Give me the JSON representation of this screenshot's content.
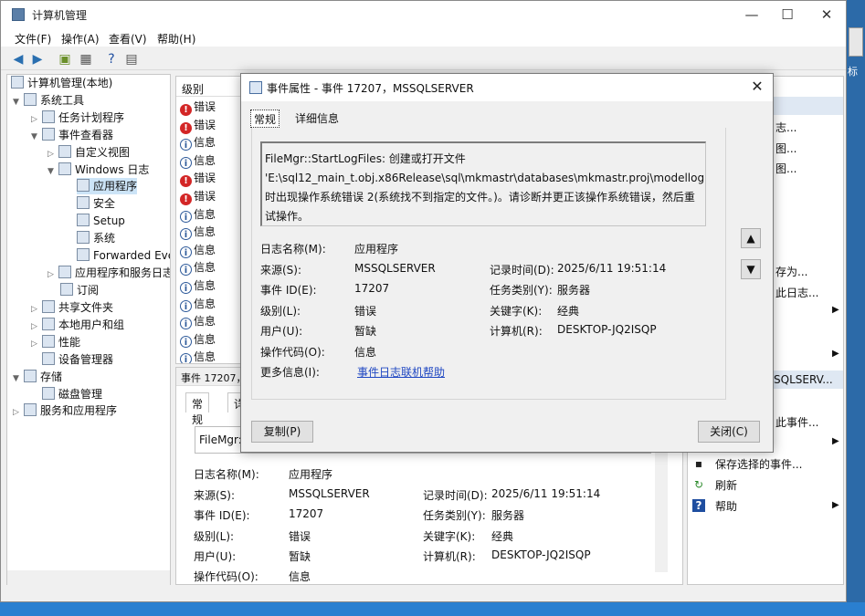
{
  "window": {
    "title": "计算机管理",
    "minimize": "—",
    "maximize": "☐",
    "close": "✕"
  },
  "menu": [
    "文件(F)",
    "操作(A)",
    "查看(V)",
    "帮助(H)"
  ],
  "tree": {
    "root": "计算机管理(本地)",
    "system_tools": "系统工具",
    "task_scheduler": "任务计划程序",
    "event_viewer": "事件查看器",
    "custom_views": "自定义视图",
    "windows_logs": "Windows 日志",
    "application": "应用程序",
    "security": "安全",
    "setup": "Setup",
    "system": "系统",
    "forwarded": "Forwarded Eve",
    "app_service_logs": "应用程序和服务日志",
    "subscriptions": "订阅",
    "shared_folders": "共享文件夹",
    "local_users": "本地用户和组",
    "performance": "性能",
    "device_manager": "设备管理器",
    "storage": "存储",
    "disk_mgmt": "磁盘管理",
    "services_apps": "服务和应用程序"
  },
  "list": {
    "header": "级别",
    "rows": [
      {
        "kind": "err",
        "label": "错误"
      },
      {
        "kind": "err",
        "label": "错误"
      },
      {
        "kind": "info",
        "label": "信息"
      },
      {
        "kind": "info",
        "label": "信息"
      },
      {
        "kind": "err",
        "label": "错误"
      },
      {
        "kind": "err",
        "label": "错误"
      },
      {
        "kind": "info",
        "label": "信息"
      },
      {
        "kind": "info",
        "label": "信息"
      },
      {
        "kind": "info",
        "label": "信息"
      },
      {
        "kind": "info",
        "label": "信息"
      },
      {
        "kind": "info",
        "label": "信息"
      },
      {
        "kind": "info",
        "label": "信息"
      },
      {
        "kind": "info",
        "label": "信息"
      },
      {
        "kind": "info",
        "label": "信息"
      },
      {
        "kind": "info",
        "label": "信息"
      }
    ]
  },
  "bottom": {
    "header": "事件 17207，",
    "tab_general": "常规",
    "tab_detail": "详",
    "msg": "FileMgr::",
    "log_name_k": "日志名称(M):",
    "log_name_v": "应用程序",
    "source_k": "来源(S):",
    "source_v": "MSSQLSERVER",
    "record_k": "记录时间(D):",
    "record_v": "2025/6/11 19:51:14",
    "event_id_k": "事件 ID(E):",
    "event_id_v": "17207",
    "task_k": "任务类别(Y):",
    "task_v": "服务器",
    "level_k": "级别(L):",
    "level_v": "错误",
    "keyword_k": "关键字(K):",
    "keyword_v": "经典",
    "user_k": "用户(U):",
    "user_v": "暂缺",
    "computer_k": "计算机(R):",
    "computer_v": "DESKTOP-JQ2ISQP",
    "opcode_k": "操作代码(O):",
    "opcode_v": "信息"
  },
  "actions": {
    "items": [
      "志...",
      "图...",
      "图...",
      "存为...",
      "此日志...",
      "SQLSERV...",
      "此事件...",
      "保存选择的事件...",
      "刷新",
      "帮助"
    ],
    "selected_header": "SQLSERV..."
  },
  "dialog": {
    "title": "事件属性 - 事件 17207，MSSQLSERVER",
    "close": "✕",
    "tab_general": "常规",
    "tab_details": "详细信息",
    "message": "FileMgr::StartLogFiles: 创建或打开文件 'E:\\sql12_main_t.obj.x86Release\\sql\\mkmastr\\databases\\mkmastr.proj\\modellog.ldf' 时出现操作系统错误 2(系统找不到指定的文件。)。请诊断并更正该操作系统错误，然后重试操作。",
    "log_name_k": "日志名称(M):",
    "log_name_v": "应用程序",
    "source_k": "来源(S):",
    "source_v": "MSSQLSERVER",
    "record_k": "记录时间(D):",
    "record_v": "2025/6/11 19:51:14",
    "event_id_k": "事件 ID(E):",
    "event_id_v": "17207",
    "task_k": "任务类别(Y):",
    "task_v": "服务器",
    "level_k": "级别(L):",
    "level_v": "错误",
    "keyword_k": "关键字(K):",
    "keyword_v": "经典",
    "user_k": "用户(U):",
    "user_v": "暂缺",
    "computer_k": "计算机(R):",
    "computer_v": "DESKTOP-JQ2ISQP",
    "opcode_k": "操作代码(O):",
    "opcode_v": "信息",
    "more_k": "更多信息(I):",
    "more_link": "事件日志联机帮助",
    "copy_btn": "复制(P)",
    "close_btn": "关闭(C)"
  },
  "desktop_label": "标"
}
